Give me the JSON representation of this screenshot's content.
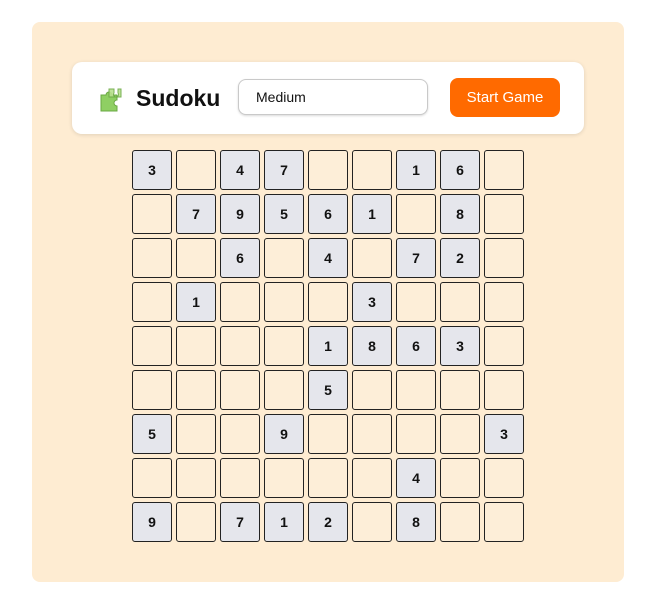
{
  "header": {
    "logo_icon": "puzzle-piece-icon",
    "title": "Sudoku",
    "difficulty_value": "Medium",
    "start_label": "Start Game"
  },
  "colors": {
    "panel_background": "#feecd2",
    "accent": "#ff6a00",
    "given_cell": "#e5e6ec",
    "empty_cell": "#fdeed8"
  },
  "board": {
    "rows": [
      [
        "3",
        "",
        "4",
        "7",
        "",
        "",
        "1",
        "6",
        ""
      ],
      [
        "",
        "7",
        "9",
        "5",
        "6",
        "1",
        "",
        "8",
        ""
      ],
      [
        "",
        "",
        "6",
        "",
        "4",
        "",
        "7",
        "2",
        ""
      ],
      [
        "",
        "1",
        "",
        "",
        "",
        "3",
        "",
        "",
        ""
      ],
      [
        "",
        "",
        "",
        "",
        "1",
        "8",
        "6",
        "3",
        ""
      ],
      [
        "",
        "",
        "",
        "",
        "5",
        "",
        "",
        "",
        ""
      ],
      [
        "5",
        "",
        "",
        "9",
        "",
        "",
        "",
        "",
        "3"
      ],
      [
        "",
        "",
        "",
        "",
        "",
        "",
        "4",
        "",
        ""
      ],
      [
        "9",
        "",
        "7",
        "1",
        "2",
        "",
        "8",
        "",
        ""
      ]
    ]
  }
}
